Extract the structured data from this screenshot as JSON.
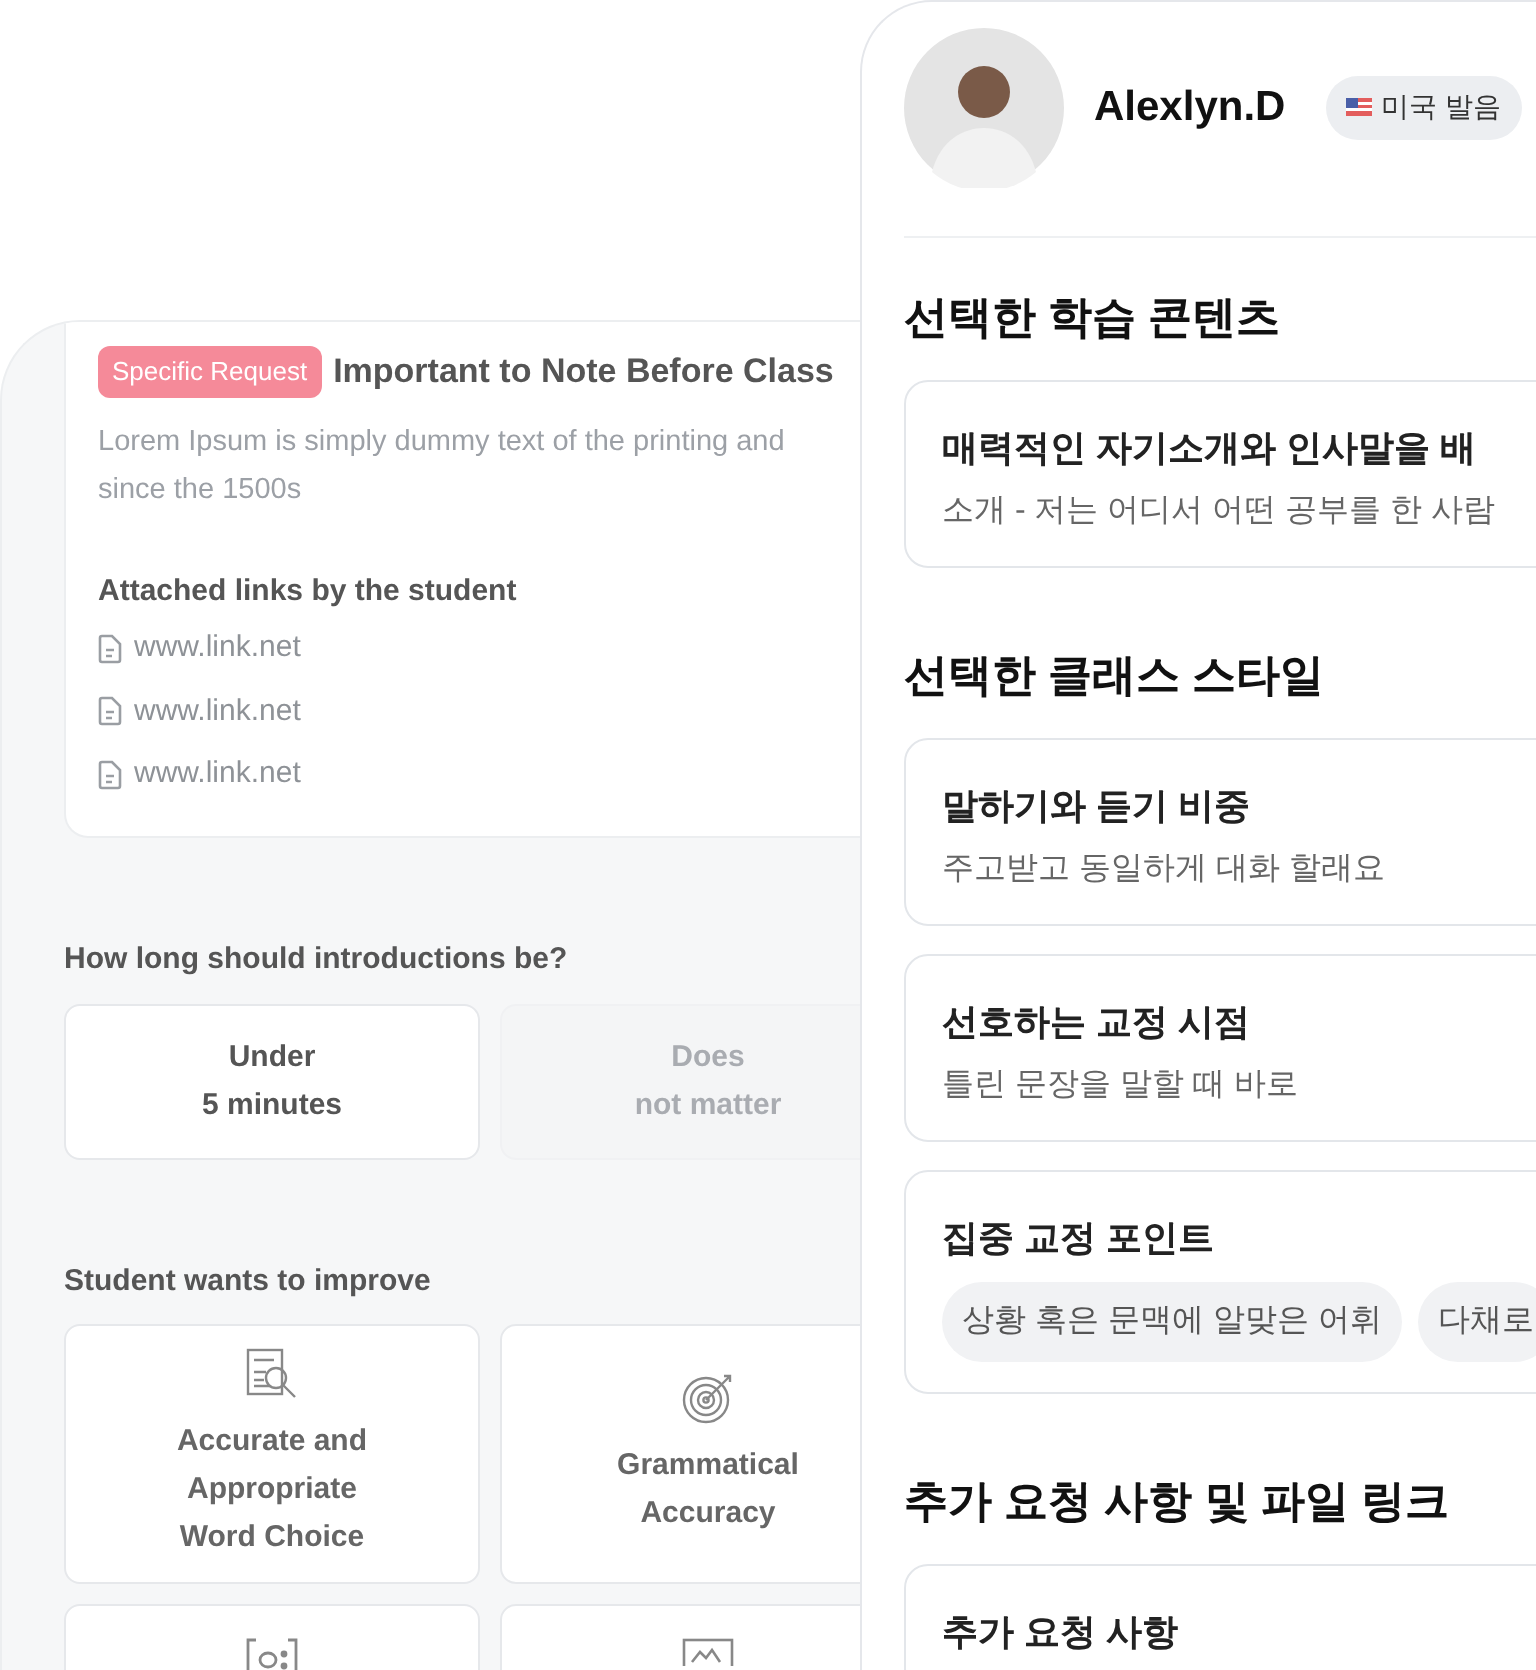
{
  "request_card": {
    "badge": "Specific Request",
    "title": "Important to Note Before Class",
    "description": "Lorem Ipsum is simply dummy text of the printing and\nsince the 1500s",
    "links_heading": "Attached links by the student",
    "links": [
      "www.link.net",
      "www.link.net",
      "www.link.net"
    ]
  },
  "intro_length": {
    "question": "How long should introductions be?",
    "options": [
      {
        "label": "Under\n5 minutes",
        "selected": true
      },
      {
        "label": "Does\nnot matter",
        "selected": false
      }
    ]
  },
  "improve": {
    "heading": "Student wants to improve",
    "items": [
      {
        "kind": "magnifier",
        "label": "Accurate and\nAppropriate\nWord Choice"
      },
      {
        "kind": "target",
        "label": "Grammatical\nAccuracy"
      },
      {
        "kind": "brackets"
      },
      {
        "kind": "picture"
      }
    ]
  },
  "profile": {
    "name": "Alexlyn.D",
    "accent_badge": "미국 발음"
  },
  "sections": [
    {
      "heading": "선택한 학습 콘텐츠",
      "cards": [
        {
          "title": "매력적인 자기소개와 인사말을 배",
          "subtitle": "소개 - 저는 어디서 어떤 공부를 한 사람"
        }
      ]
    },
    {
      "heading": "선택한 클래스 스타일",
      "cards": [
        {
          "title": "말하기와 듣기 비중",
          "subtitle": "주고받고 동일하게 대화 할래요"
        },
        {
          "title": "선호하는 교정 시점",
          "subtitle": "틀린 문장을 말할 때 바로"
        },
        {
          "title": "집중 교정 포인트",
          "tags": [
            "상황 혹은 문맥에 알맞은 어휘",
            "다채로"
          ]
        }
      ]
    },
    {
      "heading": "추가 요청 사항 및 파일 링크",
      "cards": [
        {
          "title": "추가 요청 사항"
        }
      ]
    }
  ]
}
